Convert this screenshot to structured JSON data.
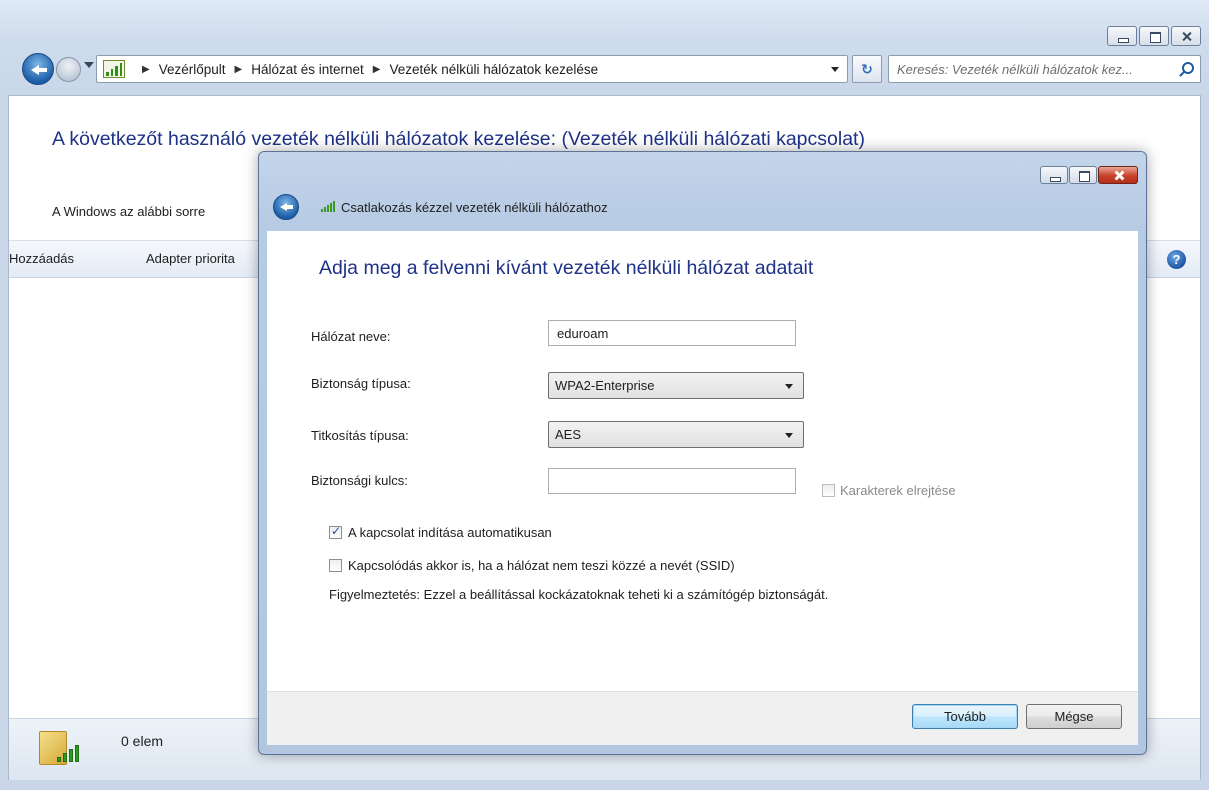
{
  "explorer": {
    "breadcrumb": [
      "Vezérlőpult",
      "Hálózat és internet",
      "Vezeték nélküli hálózatok kezelése"
    ],
    "search_placeholder": "Keresés: Vezeték nélküli hálózatok kez...",
    "title": "A következőt használó vezeték nélküli hálózatok kezelése: (Vezeték nélküli hálózati kapcsolat)",
    "description": "A Windows az alábbi sorre",
    "toolbar": {
      "add_label": "Hozzáadás",
      "adapter_label": "Adapter priorita"
    },
    "status_text": "0 elem"
  },
  "dialog": {
    "title": "Csatlakozás kézzel vezeték nélküli hálózathoz",
    "heading": "Adja meg a felvenni kívánt vezeték nélküli hálózat adatait",
    "fields": {
      "network_name_label": "Hálózat neve:",
      "network_name_value": "eduroam",
      "security_type_label": "Biztonság típusa:",
      "security_type_value": "WPA2-Enterprise",
      "encryption_type_label": "Titkosítás típusa:",
      "encryption_type_value": "AES",
      "security_key_label": "Biztonsági kulcs:",
      "security_key_value": ""
    },
    "hide_chars_label": "Karakterek elrejtése",
    "auto_connect_label": "A kapcsolat indítása automatikusan",
    "auto_connect_checked": true,
    "connect_hidden_label": "Kapcsolódás akkor is, ha a hálózat nem teszi közzé a nevét (SSID)",
    "connect_hidden_checked": false,
    "warning_text": "Figyelmeztetés: Ezzel a beállítással kockázatoknak teheti ki a számítógép biztonságát.",
    "next_button": "Tovább",
    "cancel_button": "Mégse"
  },
  "icons": {
    "back": "back-arrow-icon",
    "forward": "forward-arrow-icon",
    "network": "network-signal-icon",
    "search": "search-icon",
    "help": "help-icon",
    "refresh": "refresh-icon"
  }
}
